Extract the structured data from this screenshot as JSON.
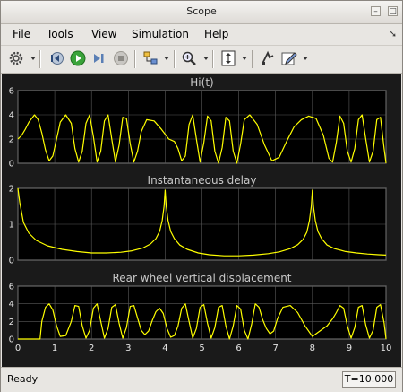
{
  "window": {
    "title": "Scope"
  },
  "menus": [
    {
      "label": "File",
      "mn": "F",
      "rest": "ile"
    },
    {
      "label": "Tools",
      "mn": "T",
      "rest": "ools"
    },
    {
      "label": "View",
      "mn": "V",
      "rest": "iew"
    },
    {
      "label": "Simulation",
      "mn": "S",
      "rest": "imulation"
    },
    {
      "label": "Help",
      "mn": "H",
      "rest": "elp"
    }
  ],
  "toolbar_icons": [
    "settings-gear-icon",
    "step-back-icon",
    "run-icon",
    "step-forward-icon",
    "stop-icon",
    "highlight-block-icon",
    "zoom-in-icon",
    "autoscale-icon",
    "signal-select-icon",
    "edit-icon"
  ],
  "status": {
    "text": "Ready",
    "time": "T=10.000"
  },
  "colors": {
    "trace": "#ffff00",
    "axes_bg": "#000000",
    "figure_bg": "#1a1a1a",
    "grid": "#5a5a5a"
  },
  "chart_data": [
    {
      "type": "line",
      "title": "Hi(t)",
      "xlim": [
        0,
        10
      ],
      "ylim": [
        0,
        6
      ],
      "xticks": [
        0,
        1,
        2,
        3,
        4,
        5,
        6,
        7,
        8,
        9,
        10
      ],
      "yticks": [
        0,
        2,
        4,
        6
      ],
      "grid": true,
      "series": [
        {
          "x": [
            0,
            0.1,
            0.2,
            0.3,
            0.45,
            0.55,
            0.65,
            0.75,
            0.85,
            0.95,
            1.05,
            1.15,
            1.3,
            1.45,
            1.55,
            1.65,
            1.75,
            1.85,
            1.95,
            2.05,
            2.15,
            2.25,
            2.35,
            2.45,
            2.55,
            2.65,
            2.75,
            2.85,
            2.95,
            3.05,
            3.15,
            3.25,
            3.35,
            3.5,
            3.7,
            3.9,
            4.1,
            4.25,
            4.35,
            4.45,
            4.55,
            4.65,
            4.75,
            4.85,
            4.95,
            5.05,
            5.15,
            5.25,
            5.35,
            5.45,
            5.55,
            5.65,
            5.75,
            5.85,
            5.95,
            6.05,
            6.15,
            6.3,
            6.5,
            6.7,
            6.9,
            7.1,
            7.3,
            7.5,
            7.7,
            7.9,
            8.1,
            8.3,
            8.45,
            8.55,
            8.65,
            8.75,
            8.85,
            8.95,
            9.05,
            9.15,
            9.25,
            9.35,
            9.45,
            9.55,
            9.65,
            9.75,
            9.85,
            9.95,
            10
          ],
          "y": [
            2.0,
            2.3,
            2.8,
            3.4,
            4.0,
            3.6,
            2.5,
            1.1,
            0.2,
            0.6,
            2.0,
            3.4,
            4.0,
            3.3,
            1.2,
            0.1,
            1.0,
            3.3,
            4.0,
            2.2,
            0.1,
            1.0,
            3.5,
            4.0,
            2.0,
            0.1,
            1.5,
            3.8,
            3.7,
            1.6,
            0.1,
            1.0,
            2.6,
            3.6,
            3.5,
            2.8,
            2.0,
            1.8,
            1.2,
            0.2,
            0.6,
            3.2,
            4.0,
            2.0,
            0.1,
            1.7,
            3.9,
            3.5,
            1.0,
            0.0,
            1.3,
            3.8,
            3.5,
            1.0,
            0.0,
            1.6,
            3.6,
            4.0,
            3.2,
            1.5,
            0.2,
            0.5,
            1.8,
            3.0,
            3.6,
            3.9,
            3.7,
            2.3,
            0.4,
            0.1,
            1.7,
            3.9,
            3.3,
            1.0,
            0.1,
            1.2,
            3.6,
            4.0,
            2.0,
            0.1,
            1.0,
            3.6,
            3.8,
            1.2,
            0.0
          ]
        }
      ]
    },
    {
      "type": "line",
      "title": "Instantaneous delay",
      "xlim": [
        0,
        10
      ],
      "ylim": [
        0,
        2
      ],
      "xticks": [
        0,
        1,
        2,
        3,
        4,
        5,
        6,
        7,
        8,
        9,
        10
      ],
      "yticks": [
        0,
        1,
        2
      ],
      "grid": true,
      "series": [
        {
          "x": [
            0,
            0.05,
            0.15,
            0.3,
            0.5,
            0.8,
            1.2,
            1.6,
            2.0,
            2.4,
            2.8,
            3.1,
            3.4,
            3.6,
            3.75,
            3.85,
            3.92,
            3.97,
            4.0,
            4.03,
            4.08,
            4.15,
            4.25,
            4.4,
            4.6,
            4.9,
            5.2,
            5.6,
            6.0,
            6.4,
            6.8,
            7.1,
            7.4,
            7.6,
            7.75,
            7.85,
            7.92,
            7.97,
            8.0,
            8.03,
            8.08,
            8.15,
            8.25,
            8.4,
            8.6,
            8.9,
            9.2,
            9.5,
            9.8,
            10
          ],
          "y": [
            2.0,
            1.6,
            1.05,
            0.75,
            0.55,
            0.4,
            0.3,
            0.24,
            0.2,
            0.2,
            0.22,
            0.26,
            0.34,
            0.45,
            0.6,
            0.8,
            1.1,
            1.5,
            1.95,
            1.5,
            1.1,
            0.8,
            0.6,
            0.42,
            0.3,
            0.2,
            0.15,
            0.12,
            0.12,
            0.14,
            0.18,
            0.23,
            0.32,
            0.43,
            0.58,
            0.78,
            1.1,
            1.5,
            1.95,
            1.5,
            1.1,
            0.8,
            0.6,
            0.42,
            0.32,
            0.24,
            0.2,
            0.17,
            0.15,
            0.14
          ]
        }
      ]
    },
    {
      "type": "line",
      "title": "Rear wheel vertical displacement",
      "xlim": [
        0,
        10
      ],
      "ylim": [
        0,
        6
      ],
      "xticks": [
        0,
        1,
        2,
        3,
        4,
        5,
        6,
        7,
        8,
        9,
        10
      ],
      "xticklabels": [
        "0",
        "1",
        "2",
        "3",
        "4",
        "5",
        "6",
        "7",
        "8",
        "9",
        "10"
      ],
      "yticks": [
        0,
        2,
        4,
        6
      ],
      "grid": true,
      "series": [
        {
          "x": [
            0,
            0.3,
            0.6,
            0.65,
            0.75,
            0.85,
            0.95,
            1.05,
            1.15,
            1.3,
            1.45,
            1.55,
            1.65,
            1.75,
            1.85,
            1.95,
            2.05,
            2.15,
            2.25,
            2.35,
            2.45,
            2.55,
            2.65,
            2.75,
            2.85,
            2.95,
            3.05,
            3.15,
            3.25,
            3.35,
            3.45,
            3.55,
            3.65,
            3.75,
            3.85,
            3.95,
            4.05,
            4.15,
            4.25,
            4.35,
            4.45,
            4.55,
            4.65,
            4.75,
            4.85,
            4.95,
            5.05,
            5.15,
            5.25,
            5.35,
            5.45,
            5.55,
            5.65,
            5.75,
            5.85,
            5.95,
            6.05,
            6.15,
            6.25,
            6.35,
            6.45,
            6.55,
            6.65,
            6.75,
            6.85,
            6.95,
            7.05,
            7.2,
            7.4,
            7.6,
            7.8,
            8.0,
            8.2,
            8.4,
            8.55,
            8.65,
            8.75,
            8.85,
            8.95,
            9.05,
            9.15,
            9.25,
            9.35,
            9.45,
            9.55,
            9.65,
            9.75,
            9.85,
            9.95,
            10
          ],
          "y": [
            0.0,
            0.0,
            0.0,
            2.0,
            3.6,
            4.0,
            3.3,
            1.5,
            0.3,
            0.4,
            2.0,
            3.8,
            3.7,
            1.5,
            0.1,
            1.0,
            3.5,
            4.0,
            2.0,
            0.1,
            1.2,
            3.6,
            3.9,
            1.8,
            0.1,
            1.3,
            3.7,
            3.8,
            2.4,
            1.0,
            0.5,
            0.9,
            2.1,
            3.1,
            3.5,
            2.9,
            1.2,
            0.2,
            0.4,
            1.5,
            3.5,
            4.0,
            2.0,
            0.1,
            1.2,
            3.6,
            3.9,
            1.8,
            0.1,
            1.3,
            3.6,
            3.8,
            1.5,
            0.0,
            1.5,
            3.8,
            3.4,
            1.0,
            0.0,
            1.7,
            4.0,
            3.6,
            2.2,
            1.2,
            0.6,
            0.9,
            2.3,
            3.6,
            3.8,
            3.0,
            1.5,
            0.3,
            0.9,
            1.5,
            2.3,
            3.0,
            3.8,
            3.5,
            1.5,
            0.1,
            1.3,
            3.6,
            3.8,
            1.6,
            0.1,
            1.0,
            3.6,
            3.9,
            1.8,
            0.0
          ]
        }
      ]
    }
  ]
}
